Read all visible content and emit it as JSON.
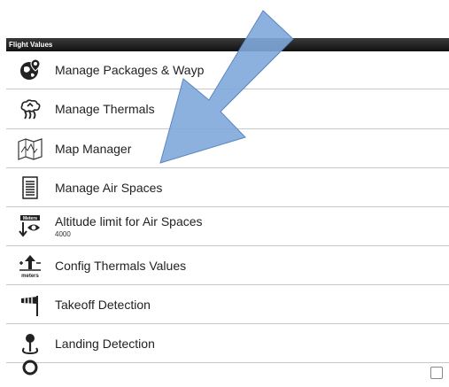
{
  "header": {
    "title": "Flight Values"
  },
  "items": [
    {
      "label": "Manage Packages & Wayp",
      "icon": "globe-pin-icon"
    },
    {
      "label": "Manage Thermals",
      "icon": "thermal-cloud-icon"
    },
    {
      "label": "Map Manager",
      "icon": "folded-map-icon"
    },
    {
      "label": "Manage Air Spaces",
      "icon": "document-lines-icon"
    },
    {
      "label": "Altitude limit for Air Spaces",
      "sublabel": "4000",
      "icon": "meters-eye-icon"
    },
    {
      "label": "Config Thermals Values",
      "icon": "meters-up-arrow-icon"
    },
    {
      "label": "Takeoff Detection",
      "icon": "windsock-icon"
    },
    {
      "label": "Landing Detection",
      "icon": "landing-pin-icon"
    }
  ],
  "overlay": {
    "arrow_color": "#7fa8dc"
  }
}
